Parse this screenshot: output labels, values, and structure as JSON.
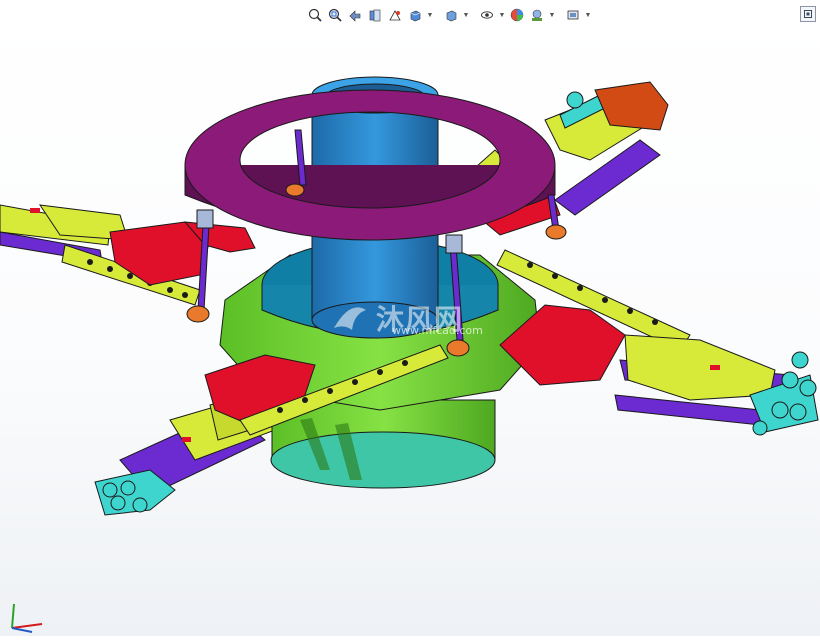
{
  "hud": {
    "tools": [
      {
        "name": "zoom-to-fit-icon",
        "tooltip": ""
      },
      {
        "name": "zoom-to-area-icon",
        "tooltip": ""
      },
      {
        "name": "previous-view-icon",
        "tooltip": ""
      },
      {
        "name": "section-view-icon",
        "tooltip": ""
      },
      {
        "name": "dynamic-annotation-icon",
        "tooltip": ""
      },
      {
        "name": "view-orientation-icon",
        "tooltip": ""
      },
      {
        "name": "display-style-icon",
        "tooltip": ""
      },
      {
        "name": "hide-show-items-icon",
        "tooltip": ""
      },
      {
        "name": "edit-appearance-icon",
        "tooltip": ""
      },
      {
        "name": "apply-scene-icon",
        "tooltip": ""
      },
      {
        "name": "view-settings-icon",
        "tooltip": ""
      }
    ]
  },
  "watermark": {
    "text": "沐风网",
    "url": "www.mfcad.com"
  },
  "colors": {
    "ring": "#8b1a78",
    "column": "#2a86c7",
    "base": "#7cdc3a",
    "arm": "#d7ea3a",
    "bracket": "#e0102a",
    "link": "#6b2bd0",
    "claw": "#3fd5cf",
    "orange": "#e97a2b",
    "outline": "#1a1a1a"
  }
}
